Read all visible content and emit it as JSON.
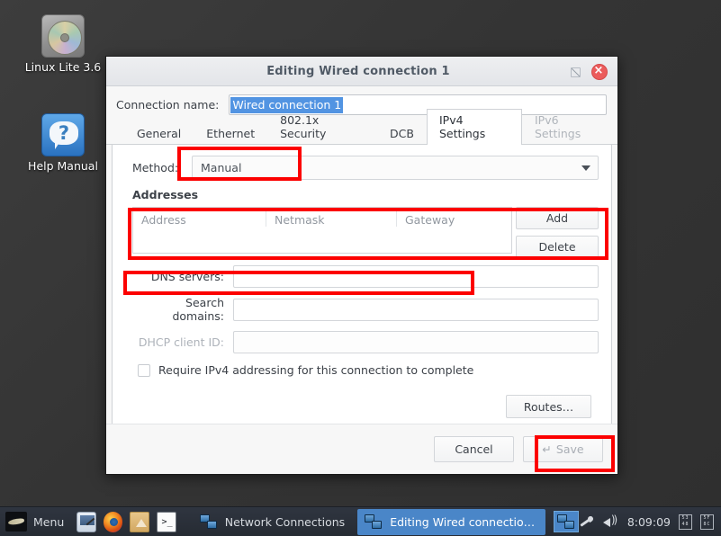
{
  "desktop": {
    "icons": [
      {
        "label": "Linux Lite 3.6",
        "icon": "dvd-disc-icon"
      },
      {
        "label": "Help Manual",
        "icon": "question-bubble-icon"
      }
    ]
  },
  "dialog": {
    "title": "Editing Wired connection 1",
    "titlebar_buttons": {
      "maximize": "maximize-icon",
      "close": "close-icon"
    },
    "connection_name": {
      "label": "Connection name:",
      "value": "Wired connection 1",
      "selected": true
    },
    "tabs": [
      {
        "label": "General",
        "state": "normal"
      },
      {
        "label": "Ethernet",
        "state": "normal"
      },
      {
        "label": "802.1x Security",
        "state": "normal"
      },
      {
        "label": "DCB",
        "state": "normal"
      },
      {
        "label": "IPv4 Settings",
        "state": "active"
      },
      {
        "label": "IPv6 Settings",
        "state": "disabled"
      }
    ],
    "ipv4": {
      "method_label": "Method:",
      "method_value": "Manual",
      "addresses_title": "Addresses",
      "address_columns": [
        "Address",
        "Netmask",
        "Gateway"
      ],
      "address_rows": [],
      "add_button": "Add",
      "delete_button": "Delete",
      "dns_label": "DNS servers:",
      "dns_value": "",
      "search_label": "Search domains:",
      "search_value": "",
      "dhcp_label": "DHCP client ID:",
      "dhcp_value": "",
      "require_checkbox_label": "Require IPv4 addressing for this connection to complete",
      "require_checked": false,
      "routes_button": "Routes…"
    },
    "footer": {
      "cancel_button": "Cancel",
      "save_button": "Save",
      "save_icon": "↵",
      "save_disabled": true
    }
  },
  "annotations": {
    "color": "#fc0000",
    "boxes": [
      {
        "name": "method-value-highlight"
      },
      {
        "name": "addresses-table-highlight"
      },
      {
        "name": "dns-servers-highlight"
      },
      {
        "name": "save-button-highlight"
      }
    ]
  },
  "taskbar": {
    "menu_label": "Menu",
    "launchers": [
      "settings-icon",
      "firefox-icon",
      "file-manager-icon",
      "terminal-icon"
    ],
    "windows": [
      {
        "label": "Network Connections",
        "active": false,
        "icon": "network-icon"
      },
      {
        "label": "Editing Wired connectio…",
        "active": true,
        "icon": "network-icon"
      }
    ],
    "tray": {
      "pin_icon": "pin-icon",
      "volume_icon": "volume-icon",
      "clock": "8:09:09",
      "glyph_boxes": [
        {
          "top": "53",
          "bottom": "48"
        },
        {
          "top": "5F",
          "bottom": "8C"
        }
      ]
    }
  }
}
